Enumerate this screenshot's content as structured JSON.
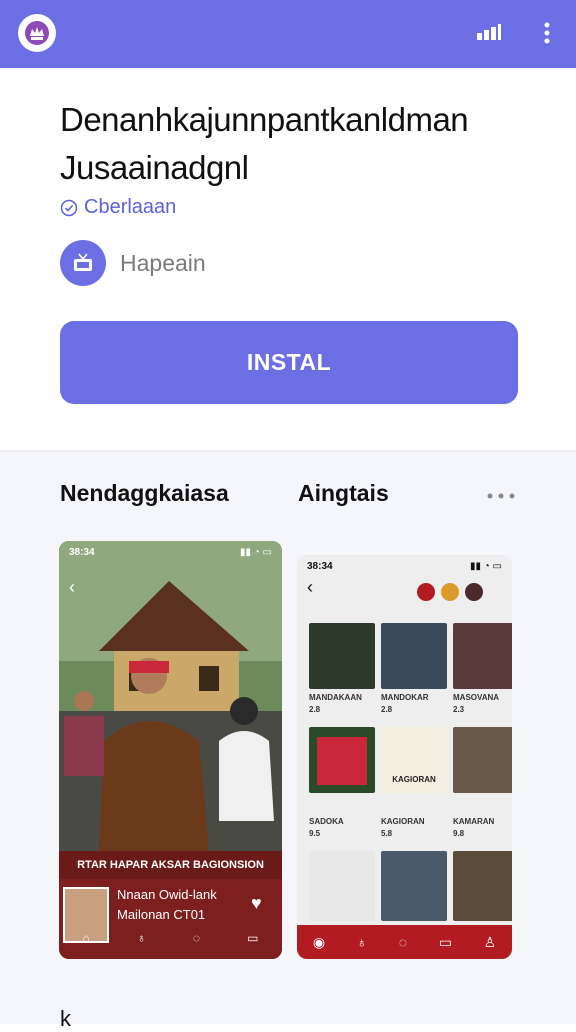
{
  "header": {
    "logo_icon": "app-crown-logo-icon",
    "signal_icon": "signal-bars-icon",
    "menu_icon": "more-vertical-icon",
    "accent_color": "#6b6fe3"
  },
  "app": {
    "title_line1": "Denanhkajunnpantkanldman",
    "title_line2": "Jusaainadgnl",
    "verified_label": "Cberlaaan",
    "developer_name": "Hapeain",
    "developer_icon": "tv-icon",
    "install_label": "INSTAL"
  },
  "tabs": [
    {
      "label": "Nendaggkaiasa"
    },
    {
      "label": "Aingtais"
    }
  ],
  "screenshot1": {
    "status_time": "38:34",
    "caption": "RTAR HAPAR AKSAR BAGIONSION",
    "profile_name": "Nnaan Owid-lank",
    "profile_sub": "Mailonan CT01"
  },
  "screenshot2": {
    "status_time": "38:34",
    "tiles": [
      {
        "label": "MANDAKAAN",
        "count": "2.8"
      },
      {
        "label": "MANDOKAR",
        "count": "2.8"
      },
      {
        "label": "MASOVANA",
        "count": "2.3"
      },
      {
        "label": "SADOKA",
        "count": "9.5"
      },
      {
        "label": "KAGIORAN",
        "count": "5.8"
      },
      {
        "label": "KAMARAN",
        "count": "9.8"
      }
    ],
    "badge_text": "KAGIORAN"
  },
  "footer": {
    "partial_text": "k"
  }
}
